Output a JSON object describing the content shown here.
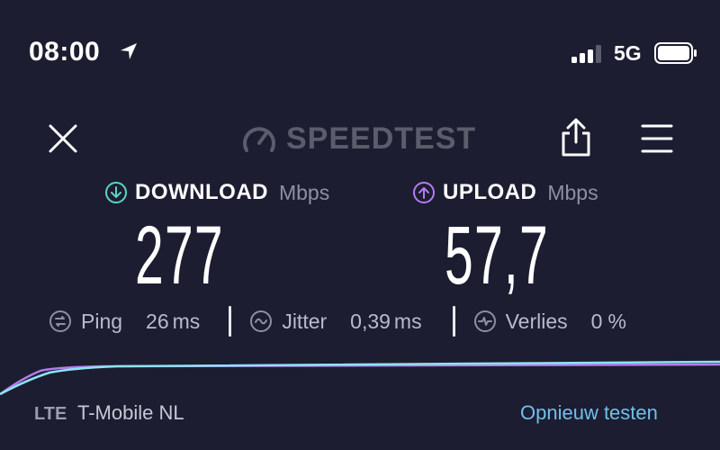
{
  "status_bar": {
    "time": "08:00",
    "network": "5G",
    "icons": [
      "location-arrow-icon",
      "signal-bars-icon",
      "battery-icon"
    ]
  },
  "header": {
    "brand": "SPEEDTEST",
    "icons": [
      "close-icon",
      "speedtest-logo-icon",
      "share-icon",
      "hamburger-menu-icon"
    ]
  },
  "results": {
    "download": {
      "label": "DOWNLOAD",
      "unit": "Mbps",
      "value": "277",
      "accent": "#5ed2c6"
    },
    "upload": {
      "label": "UPLOAD",
      "unit": "Mbps",
      "value": "57,7",
      "accent": "#b57cf0"
    }
  },
  "stats": {
    "ping": {
      "label": "Ping",
      "value": "26",
      "unit": "ms"
    },
    "jitter": {
      "label": "Jitter",
      "value": "0,39",
      "unit": "ms"
    },
    "loss": {
      "label": "Verlies",
      "value": "0",
      "unit": "%"
    }
  },
  "footer": {
    "connection_type": "LTE",
    "carrier": "T-Mobile NL",
    "retry_label": "Opnieuw testen"
  },
  "colors": {
    "background": "#1c1d31",
    "download_line": "#8ee3f0",
    "upload_line": "#b57cf0",
    "link": "#6fc0ec"
  }
}
